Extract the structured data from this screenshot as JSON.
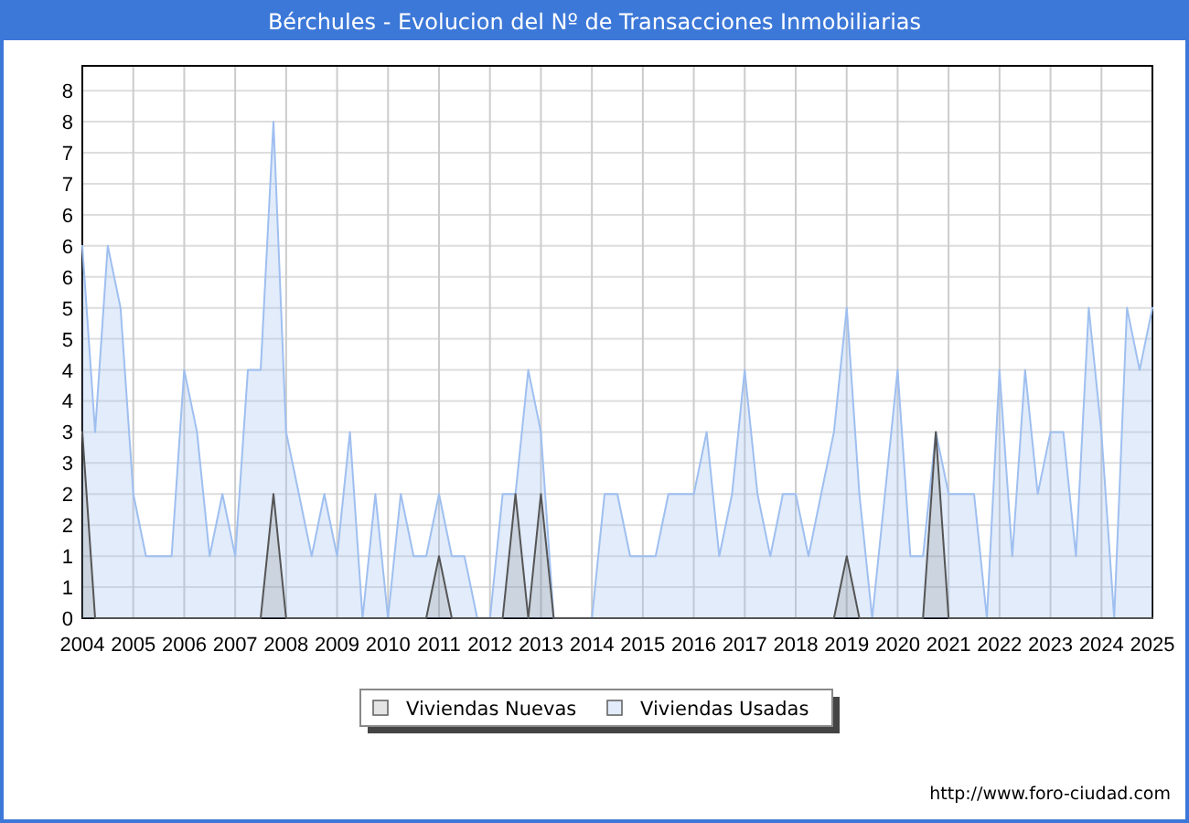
{
  "window": {
    "title": "Bérchules - Evolucion del Nº de Transacciones Inmobiliarias"
  },
  "chart": {
    "chart_data": {
      "type": "area",
      "x": [
        2004,
        2004.25,
        2004.5,
        2004.75,
        2005,
        2005.25,
        2005.5,
        2005.75,
        2006,
        2006.25,
        2006.5,
        2006.75,
        2007,
        2007.25,
        2007.5,
        2007.75,
        2008,
        2008.25,
        2008.5,
        2008.75,
        2009,
        2009.25,
        2009.5,
        2009.75,
        2010,
        2010.25,
        2010.5,
        2010.75,
        2011,
        2011.25,
        2011.5,
        2011.75,
        2012,
        2012.25,
        2012.5,
        2012.75,
        2013,
        2013.25,
        2013.5,
        2013.75,
        2014,
        2014.25,
        2014.5,
        2014.75,
        2015,
        2015.25,
        2015.5,
        2015.75,
        2016,
        2016.25,
        2016.5,
        2016.75,
        2017,
        2017.25,
        2017.5,
        2017.75,
        2018,
        2018.25,
        2018.5,
        2018.75,
        2019,
        2019.25,
        2019.5,
        2019.75,
        2020,
        2020.25,
        2020.5,
        2020.75,
        2021,
        2021.25,
        2021.5,
        2021.75,
        2022,
        2022.25,
        2022.5,
        2022.75,
        2023,
        2023.25,
        2023.5,
        2023.75,
        2024,
        2024.25,
        2024.5,
        2024.75,
        2025
      ],
      "series": [
        {
          "name": "Viviendas Nuevas",
          "color": "#555555",
          "values": [
            3,
            0,
            0,
            0,
            0,
            0,
            0,
            0,
            0,
            0,
            0,
            0,
            0,
            0,
            0,
            2,
            0,
            0,
            0,
            0,
            0,
            0,
            0,
            0,
            0,
            0,
            0,
            0,
            1,
            0,
            0,
            0,
            0,
            0,
            2,
            0,
            2,
            0,
            0,
            0,
            0,
            0,
            0,
            0,
            0,
            0,
            0,
            0,
            0,
            0,
            0,
            0,
            0,
            0,
            0,
            0,
            0,
            0,
            0,
            0,
            1,
            0,
            0,
            0,
            0,
            0,
            0,
            3,
            0,
            0,
            0,
            0,
            0,
            0,
            0,
            0,
            0,
            0,
            0,
            0,
            0,
            0,
            0,
            0,
            0
          ]
        },
        {
          "name": "Viviendas Usadas",
          "color": "#9fbff0",
          "values": [
            6,
            3,
            6,
            5,
            2,
            1,
            1,
            1,
            4,
            3,
            1,
            2,
            1,
            4,
            4,
            8,
            3,
            2,
            1,
            2,
            1,
            3,
            0,
            2,
            0,
            2,
            1,
            1,
            2,
            1,
            1,
            0,
            0,
            2,
            2,
            4,
            3,
            0,
            0,
            0,
            0,
            2,
            2,
            1,
            1,
            1,
            2,
            2,
            2,
            3,
            1,
            2,
            4,
            2,
            1,
            2,
            2,
            1,
            2,
            3,
            5,
            2,
            0,
            2,
            4,
            1,
            1,
            3,
            2,
            2,
            2,
            0,
            4,
            1,
            4,
            2,
            3,
            3,
            1,
            5,
            3,
            0,
            5,
            4,
            5
          ]
        }
      ],
      "grid": true,
      "legend": true,
      "xlim": [
        2004,
        2025
      ],
      "ylim": [
        0,
        8.9
      ],
      "xticks": [
        2004,
        2005,
        2006,
        2007,
        2008,
        2009,
        2010,
        2011,
        2012,
        2013,
        2014,
        2015,
        2016,
        2017,
        2018,
        2019,
        2020,
        2021,
        2022,
        2023,
        2024,
        2025
      ],
      "yticks": [
        {
          "value": 0,
          "label": "0"
        },
        {
          "value": 0.5,
          "label": "1"
        },
        {
          "value": 1,
          "label": "1"
        },
        {
          "value": 1.5,
          "label": "2"
        },
        {
          "value": 2,
          "label": "2"
        },
        {
          "value": 2.5,
          "label": "3"
        },
        {
          "value": 3,
          "label": "3"
        },
        {
          "value": 3.5,
          "label": "4"
        },
        {
          "value": 4,
          "label": "4"
        },
        {
          "value": 4.5,
          "label": "5"
        },
        {
          "value": 5,
          "label": "5"
        },
        {
          "value": 5.5,
          "label": "6"
        },
        {
          "value": 6,
          "label": "6"
        },
        {
          "value": 6.5,
          "label": "6"
        },
        {
          "value": 7,
          "label": "7"
        },
        {
          "value": 7.5,
          "label": "7"
        },
        {
          "value": 8,
          "label": "8"
        },
        {
          "value": 8.5,
          "label": "8"
        }
      ]
    }
  },
  "footer": {
    "url": "http://www.foro-ciudad.com"
  }
}
